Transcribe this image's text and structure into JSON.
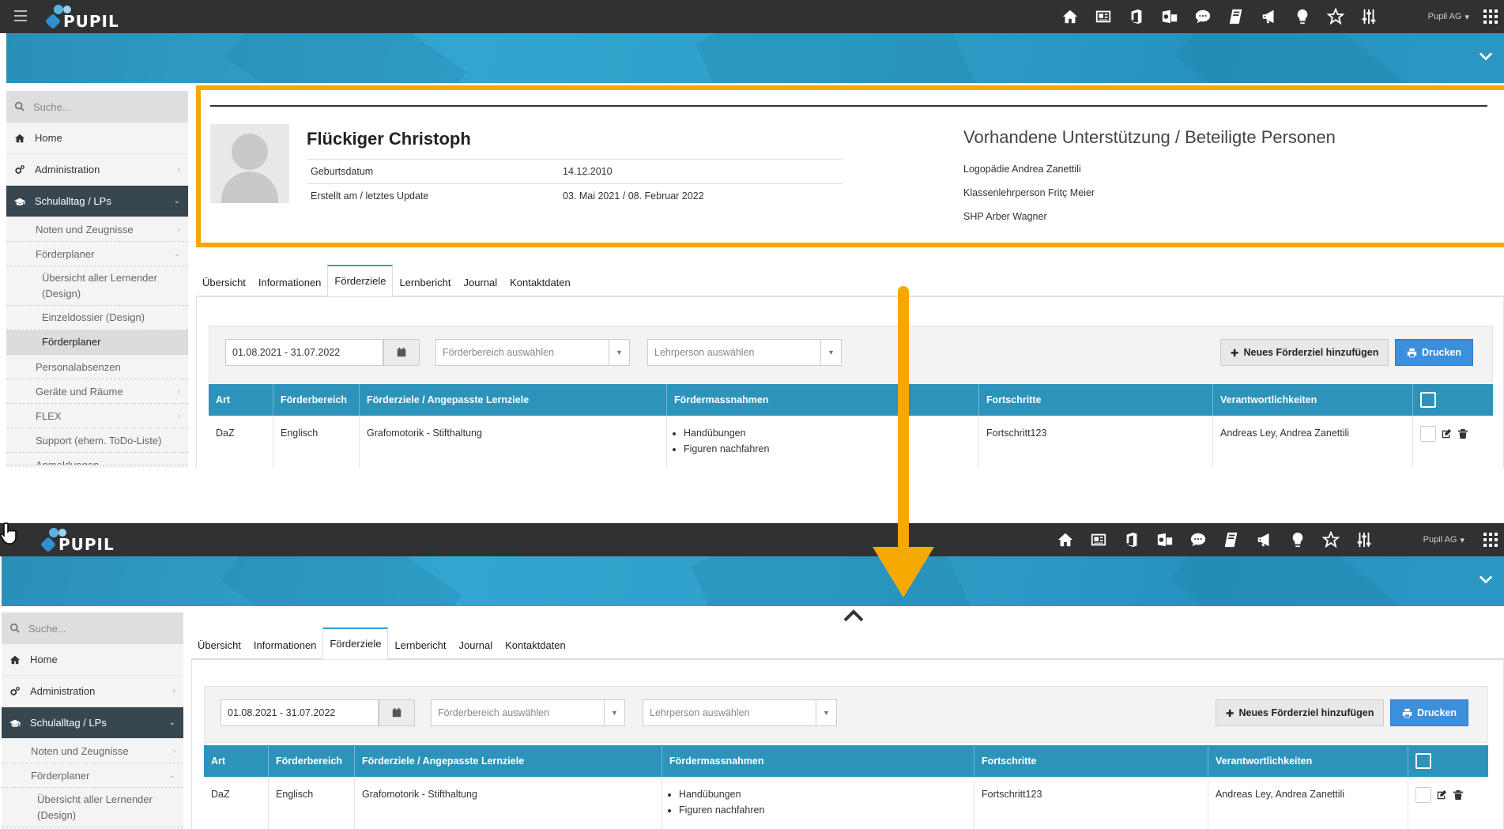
{
  "app": {
    "logo_text": "PUPIL",
    "user_label": "Pupil AG"
  },
  "topbar_icons": [
    "home-icon",
    "contact-card-icon",
    "office-icon",
    "outlook-icon",
    "chat-icon",
    "notebook-icon",
    "megaphone-icon",
    "lightbulb-icon",
    "star-icon",
    "sliders-icon"
  ],
  "sidebar": {
    "search_placeholder": "Suche...",
    "home": "Home",
    "administration": "Administration",
    "schulalltag": "Schulalltag / LPs",
    "noten": "Noten und Zeugnisse",
    "foerderplaner": "Förderplaner",
    "uebersicht_lernende": "Übersicht aller Lernender (Design)",
    "einzeldossier": "Einzeldossier (Design)",
    "foerderplaner_current": "Förderplaner",
    "personalabsenzen": "Personalabsenzen",
    "geraete": "Geräte und Räume",
    "flex": "FLEX",
    "support": "Support (ehem. ToDo-Liste)",
    "anmeldungen": "Anmeldungen"
  },
  "profile": {
    "name": "Flückiger Christoph",
    "rows": [
      {
        "label": "Geburtsdatum",
        "value": "14.12.2010"
      },
      {
        "label": "Erstellt am / letztes Update",
        "value": "03. Mai 2021 / 08. Februar 2022"
      }
    ],
    "support_title": "Vorhandene Unterstützung / Beteiligte Personen",
    "support": [
      "Logopädie Andrea Zanettili",
      "Klassenlehrperson Fritç Meier",
      "SHP Arber Wagner"
    ]
  },
  "tabs": [
    "Übersicht",
    "Informationen",
    "Förderziele",
    "Lernbericht",
    "Journal",
    "Kontaktdaten"
  ],
  "active_tab": "Förderziele",
  "filters": {
    "date_range": "01.08.2021 - 31.07.2022",
    "foerderbereich_placeholder": "Förderbereich auswählen",
    "lehrperson_placeholder": "Lehrperson auswählen",
    "add_button": "Neues Förderziel hinzufügen",
    "print_button": "Drucken"
  },
  "table": {
    "headers": [
      "Art",
      "Förderbereich",
      "Förderziele / Angepasste Lernziele",
      "Fördermassnahmen",
      "Fortschritte",
      "Verantwortlichkeiten"
    ],
    "row": {
      "art": "DaZ",
      "bereich": "Englisch",
      "ziel": "Grafomotorik - Stifthaltung",
      "massnahmen": [
        "Handübungen",
        "Figuren nachfahren"
      ],
      "fortschritte": "Fortschritt123",
      "verantwortlich": "Andreas Ley, Andrea Zanettili"
    }
  },
  "colors": {
    "topbar": "#2f3133",
    "banner": "#2ea0c8",
    "highlight": "#f5a800",
    "table_header": "#2d93ba",
    "print_button": "#3b8fdb",
    "sidebar_active": "#37464f"
  }
}
